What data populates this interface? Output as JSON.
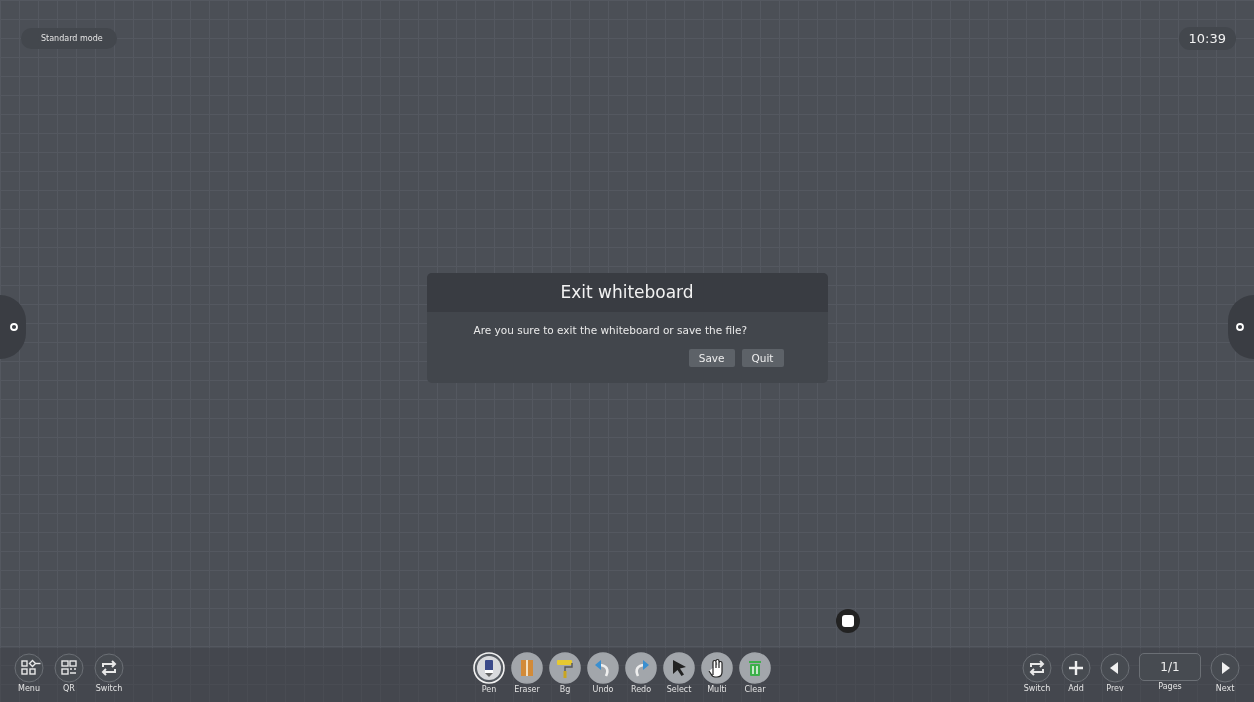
{
  "mode_badge": "Standard mode",
  "clock": "10:39",
  "dialog": {
    "title": "Exit whiteboard",
    "message": "Are you sure to exit the whiteboard or save the file?",
    "buttons": [
      "Save",
      "Quit"
    ]
  },
  "left_tools": [
    {
      "kind": "menu",
      "label": "Menu"
    },
    {
      "kind": "qr",
      "label": "QR"
    },
    {
      "kind": "switch",
      "label": "Switch"
    }
  ],
  "tools": [
    {
      "kind": "pen",
      "label": "Pen",
      "selected": true
    },
    {
      "kind": "eraser",
      "label": "Eraser",
      "selected": false
    },
    {
      "kind": "bg",
      "label": "Bg",
      "selected": false
    },
    {
      "kind": "undo",
      "label": "Undo",
      "selected": false
    },
    {
      "kind": "redo",
      "label": "Redo",
      "selected": false
    },
    {
      "kind": "select",
      "label": "Select",
      "selected": false
    },
    {
      "kind": "multi",
      "label": "Multi",
      "selected": false
    },
    {
      "kind": "clear",
      "label": "Clear",
      "selected": false
    }
  ],
  "right_tools": [
    {
      "kind": "switch",
      "label": "Switch"
    },
    {
      "kind": "add",
      "label": "Add"
    },
    {
      "kind": "prev",
      "label": "Prev"
    },
    {
      "kind": "pages",
      "label": "Pages",
      "value": "1/1"
    },
    {
      "kind": "next",
      "label": "Next"
    }
  ]
}
